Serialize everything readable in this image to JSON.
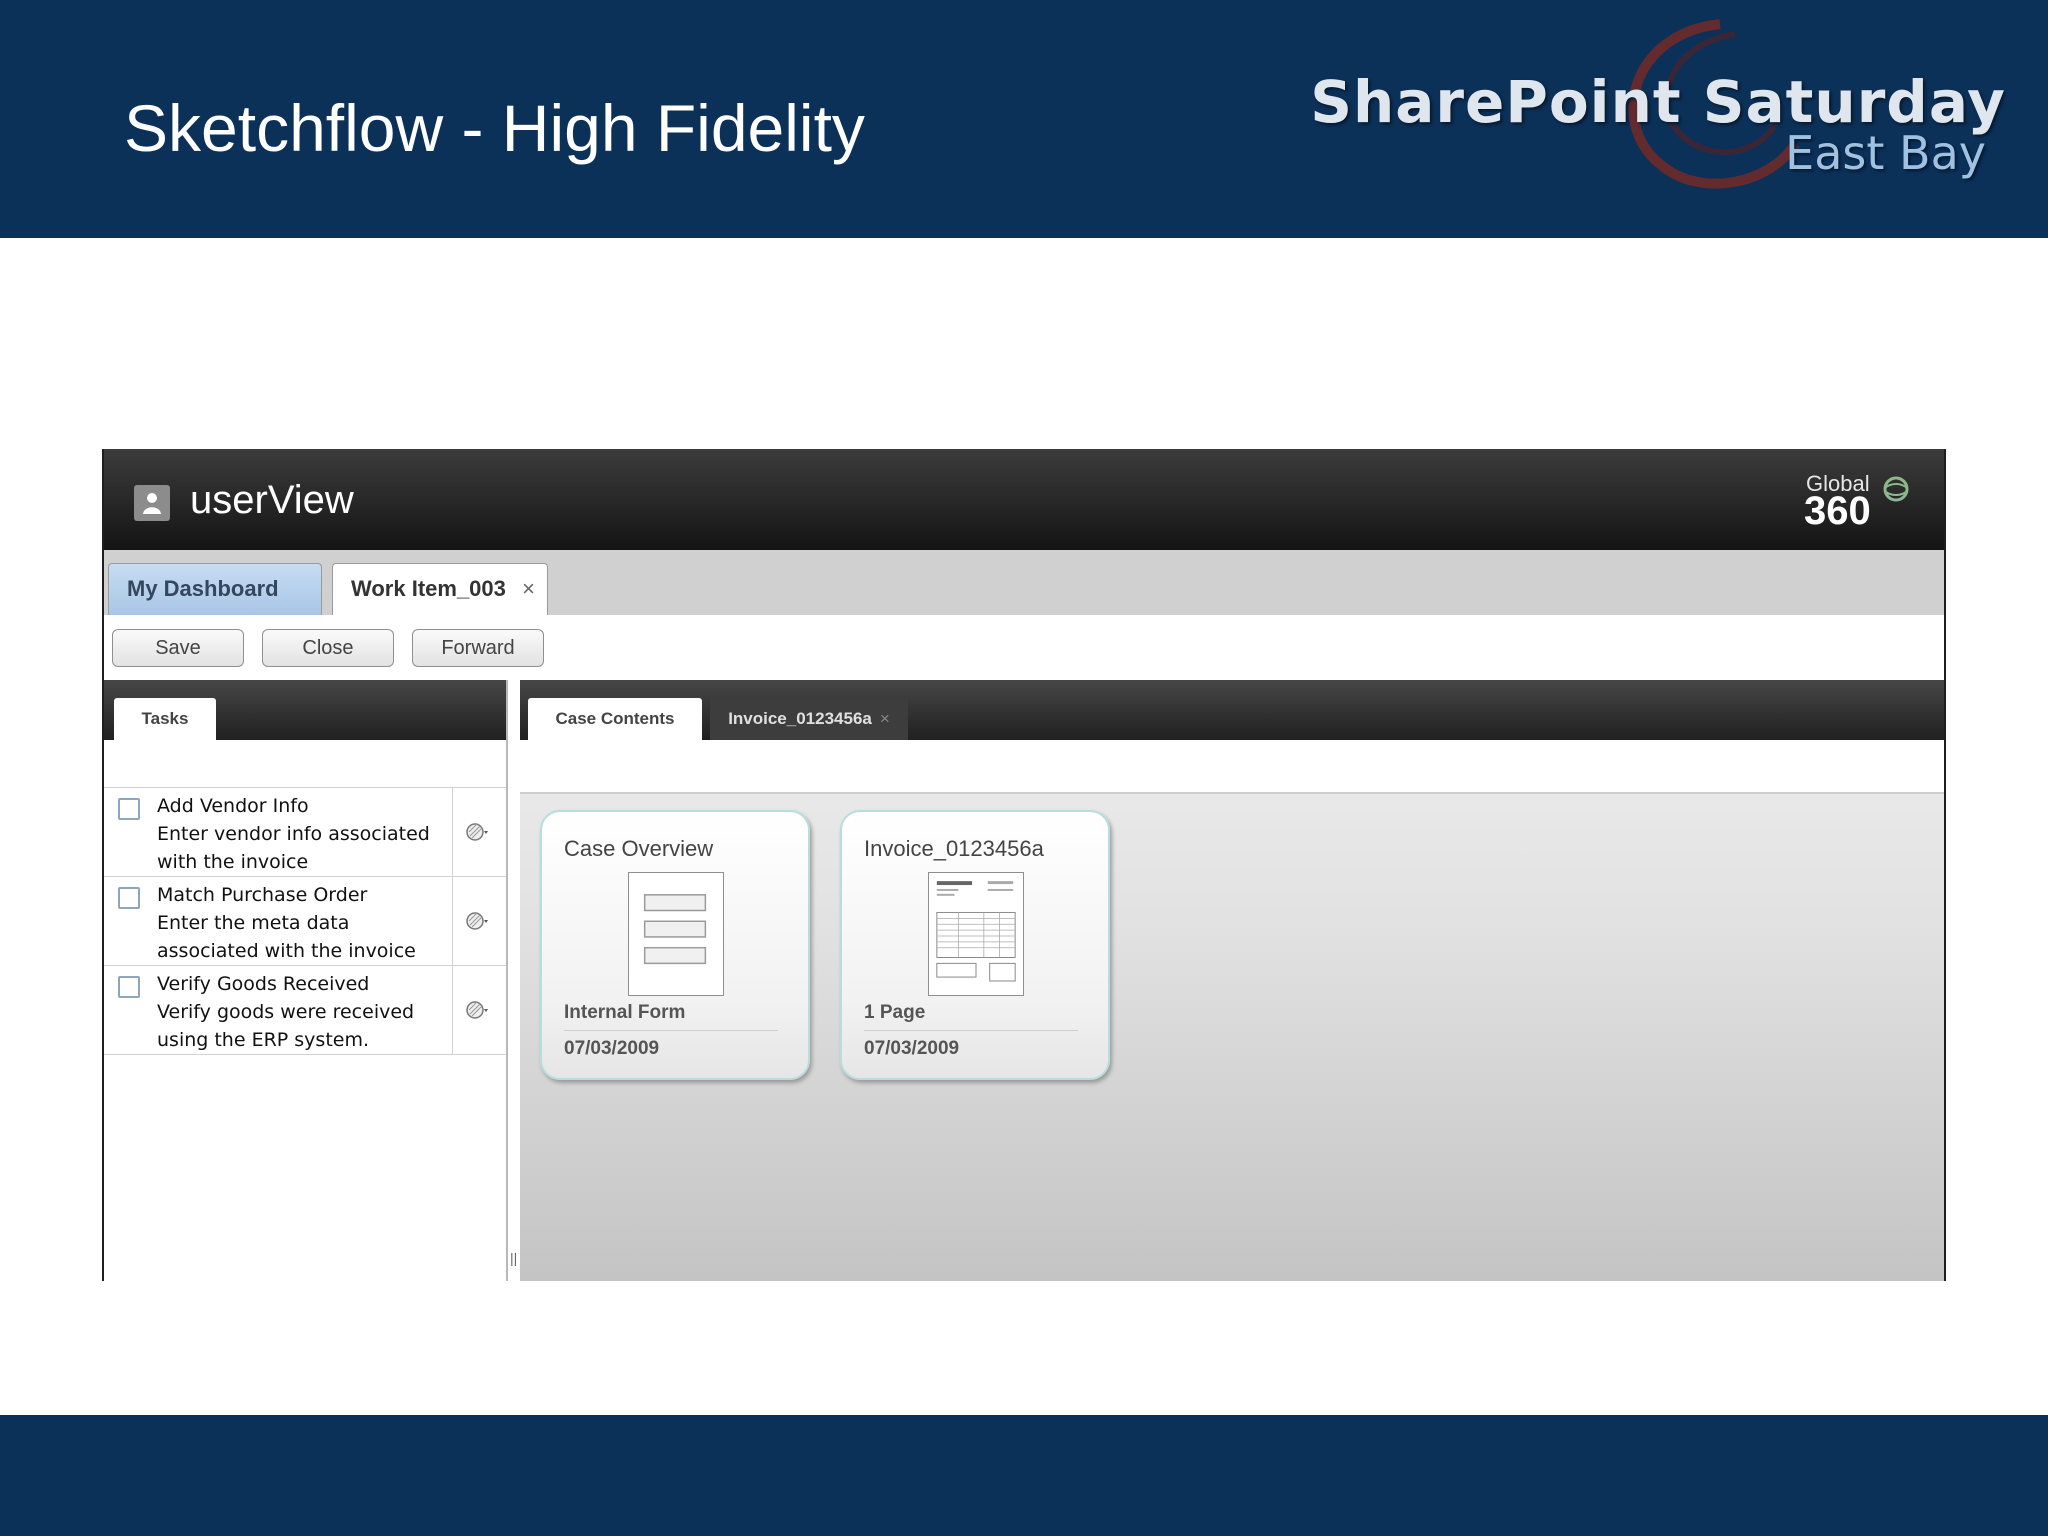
{
  "slide": {
    "title": "Sketchflow - High Fidelity",
    "brand": {
      "line1": "SharePoint Saturday",
      "line2": "East Bay"
    },
    "colors": {
      "header_bg": "#0c3159",
      "footer_bg": "#0c3159"
    }
  },
  "app": {
    "name": "userView",
    "user_icon": "user-icon",
    "vendor_logo": {
      "top": "Global",
      "number": "360",
      "icon": "globe-icon"
    },
    "doc_tabs": [
      {
        "label": "My Dashboard",
        "active": false
      },
      {
        "label": "Work Item_003",
        "active": true,
        "close": "×"
      }
    ],
    "actions": {
      "save": "Save",
      "close": "Close",
      "forward": "Forward"
    },
    "left_panel": {
      "tab": "Tasks",
      "tasks": [
        {
          "title": "Add Vendor Info",
          "description": "Enter vendor info associated with the invoice",
          "checked": false
        },
        {
          "title": "Match Purchase Order",
          "description": "Enter the meta data associated with the invoice",
          "checked": false
        },
        {
          "title": "Verify Goods Received",
          "description": "Verify goods were received using the ERP system.",
          "checked": false
        }
      ]
    },
    "right_panel": {
      "tabs": [
        {
          "label": "Case Contents",
          "active": true
        },
        {
          "label": "Invoice_0123456a",
          "active": false,
          "close": "×"
        }
      ],
      "cards": [
        {
          "title": "Case Overview",
          "meta": "Internal Form",
          "date": "07/03/2009",
          "thumb": "form-thumbnail"
        },
        {
          "title": "Invoice_0123456a",
          "meta": "1 Page",
          "date": "07/03/2009",
          "thumb": "invoice-thumbnail"
        }
      ]
    },
    "splitter_grip": "||"
  }
}
